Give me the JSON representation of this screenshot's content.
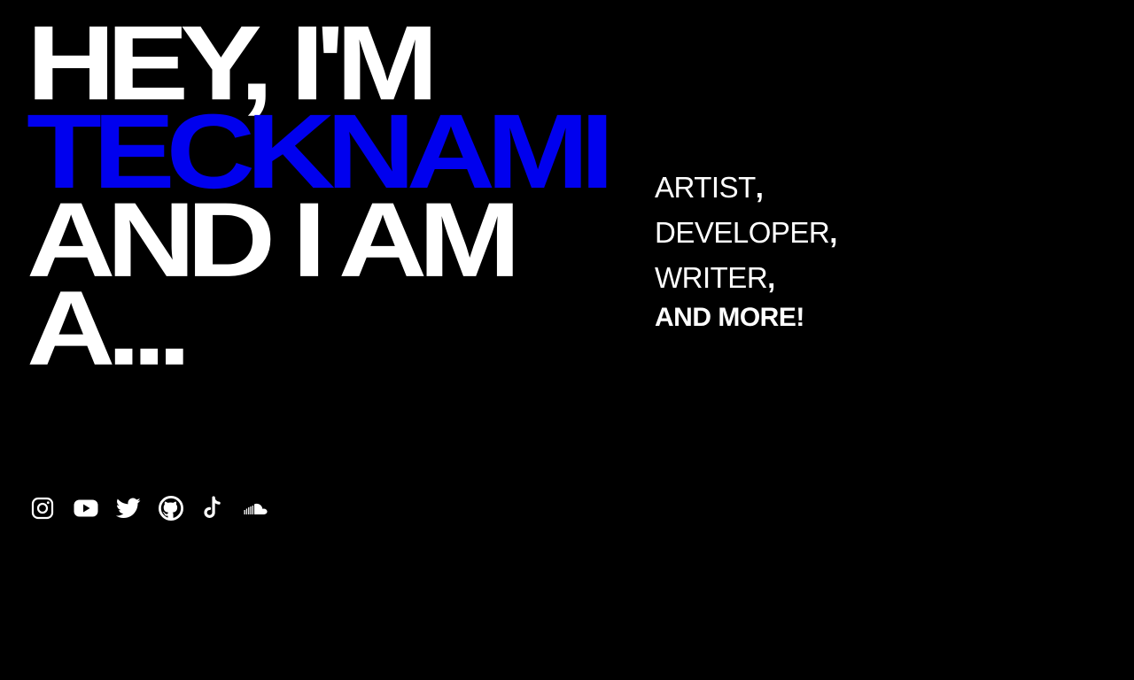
{
  "hero": {
    "line1": "HEY, I'M",
    "name": "TECKNAMI",
    "line3": "AND I AM",
    "line4": "A..."
  },
  "roles": [
    {
      "word": "ARTIST",
      "comma": ","
    },
    {
      "word": "DEVELOPER",
      "comma": ","
    },
    {
      "word": "WRITER",
      "comma": ","
    }
  ],
  "roles_final": "AND MORE!",
  "socials": [
    {
      "icon": "instagram-icon"
    },
    {
      "icon": "youtube-icon"
    },
    {
      "icon": "twitter-icon"
    },
    {
      "icon": "github-icon"
    },
    {
      "icon": "tiktok-icon"
    },
    {
      "icon": "soundcloud-icon"
    }
  ],
  "colors": {
    "background": "#000000",
    "text": "#ffffff",
    "accent": "#0000ee"
  }
}
